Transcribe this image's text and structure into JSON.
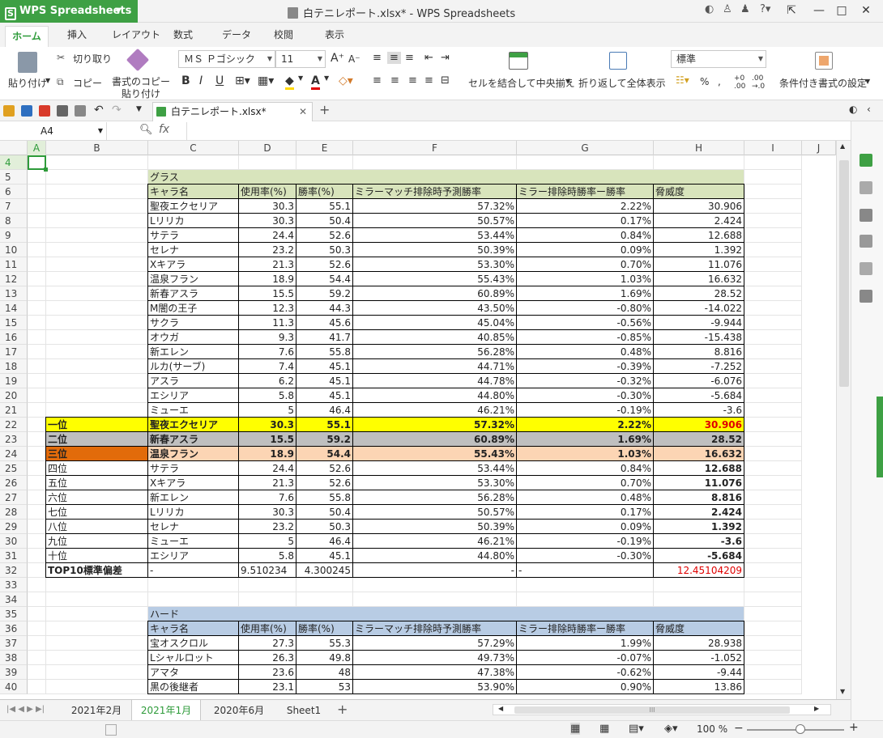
{
  "app": {
    "name": "WPS Spreadsheets",
    "window_title": "白テニレポート.xlsx* - WPS Spreadsheets",
    "doc_tab": "白テニレポート.xlsx*"
  },
  "menu": [
    "ホーム",
    "挿入",
    "レイアウト",
    "数式",
    "データ",
    "校閲",
    "表示"
  ],
  "ribbon": {
    "paste": "貼り付け",
    "cut": "切り取り",
    "copy": "コピー",
    "format_copy_1": "書式のコピー",
    "format_copy_2": "貼り付け",
    "font": "ＭＳ Ｐゴシック",
    "size": "11",
    "bold": "B",
    "italic": "I",
    "underline": "U",
    "merge": "セルを結合して中央揃え",
    "wrap": "折り返して全体表示",
    "numfmt": "標準",
    "percent": "%",
    "comma": ",",
    "cond": "条件付き書式の設定"
  },
  "namebox": "A4",
  "fx": "fx",
  "columns": [
    "A",
    "B",
    "C",
    "D",
    "E",
    "F",
    "G",
    "H",
    "I",
    "J"
  ],
  "rows": [
    "4",
    "5",
    "6",
    "7",
    "8",
    "9",
    "10",
    "11",
    "12",
    "13",
    "14",
    "15",
    "16",
    "17",
    "18",
    "19",
    "20",
    "21",
    "22",
    "23",
    "24",
    "25",
    "26",
    "27",
    "28",
    "29",
    "30",
    "31",
    "32",
    "33",
    "34",
    "35",
    "36",
    "37",
    "38",
    "39",
    "40"
  ],
  "grass": {
    "title": "グラス",
    "headers": [
      "キャラ名",
      "使用率(%)",
      "勝率(%)",
      "ミラーマッチ排除時予測勝率",
      "ミラー排除時勝率ー勝率",
      "脅威度"
    ],
    "rows": [
      [
        "聖夜エクセリア",
        "30.3",
        "55.1",
        "57.32%",
        "2.22%",
        "30.906"
      ],
      [
        "Lリリカ",
        "30.3",
        "50.4",
        "50.57%",
        "0.17%",
        "2.424"
      ],
      [
        "サテラ",
        "24.4",
        "52.6",
        "53.44%",
        "0.84%",
        "12.688"
      ],
      [
        "セレナ",
        "23.2",
        "50.3",
        "50.39%",
        "0.09%",
        "1.392"
      ],
      [
        "Xキアラ",
        "21.3",
        "52.6",
        "53.30%",
        "0.70%",
        "11.076"
      ],
      [
        "温泉フラン",
        "18.9",
        "54.4",
        "55.43%",
        "1.03%",
        "16.632"
      ],
      [
        "新春アスラ",
        "15.5",
        "59.2",
        "60.89%",
        "1.69%",
        "28.52"
      ],
      [
        "M闇の王子",
        "12.3",
        "44.3",
        "43.50%",
        "-0.80%",
        "-14.022"
      ],
      [
        "サクラ",
        "11.3",
        "45.6",
        "45.04%",
        "-0.56%",
        "-9.944"
      ],
      [
        "オウガ",
        "9.3",
        "41.7",
        "40.85%",
        "-0.85%",
        "-15.438"
      ],
      [
        "新エレン",
        "7.6",
        "55.8",
        "56.28%",
        "0.48%",
        "8.816"
      ],
      [
        "ルカ(サーブ)",
        "7.4",
        "45.1",
        "44.71%",
        "-0.39%",
        "-7.252"
      ],
      [
        "アスラ",
        "6.2",
        "45.1",
        "44.78%",
        "-0.32%",
        "-6.076"
      ],
      [
        "エシリア",
        "5.8",
        "45.1",
        "44.80%",
        "-0.30%",
        "-5.684"
      ],
      [
        "ミューエ",
        "5",
        "46.4",
        "46.21%",
        "-0.19%",
        "-3.6"
      ]
    ]
  },
  "ranking": [
    [
      "一位",
      "聖夜エクセリア",
      "30.3",
      "55.1",
      "57.32%",
      "2.22%",
      "30.906"
    ],
    [
      "二位",
      "新春アスラ",
      "15.5",
      "59.2",
      "60.89%",
      "1.69%",
      "28.52"
    ],
    [
      "三位",
      "温泉フラン",
      "18.9",
      "54.4",
      "55.43%",
      "1.03%",
      "16.632"
    ],
    [
      "四位",
      "サテラ",
      "24.4",
      "52.6",
      "53.44%",
      "0.84%",
      "12.688"
    ],
    [
      "五位",
      "Xキアラ",
      "21.3",
      "52.6",
      "53.30%",
      "0.70%",
      "11.076"
    ],
    [
      "六位",
      "新エレン",
      "7.6",
      "55.8",
      "56.28%",
      "0.48%",
      "8.816"
    ],
    [
      "七位",
      "Lリリカ",
      "30.3",
      "50.4",
      "50.57%",
      "0.17%",
      "2.424"
    ],
    [
      "八位",
      "セレナ",
      "23.2",
      "50.3",
      "50.39%",
      "0.09%",
      "1.392"
    ],
    [
      "九位",
      "ミューエ",
      "5",
      "46.4",
      "46.21%",
      "-0.19%",
      "-3.6"
    ],
    [
      "十位",
      "エシリア",
      "5.8",
      "45.1",
      "44.80%",
      "-0.30%",
      "-5.684"
    ]
  ],
  "stddev": [
    "TOP10標準偏差",
    "-",
    "9.510234",
    "4.300245",
    "-",
    "-",
    "12.45104209"
  ],
  "hard": {
    "title": "ハード",
    "headers": [
      "キャラ名",
      "使用率(%)",
      "勝率(%)",
      "ミラーマッチ排除時予測勝率",
      "ミラー排除時勝率ー勝率",
      "脅威度"
    ],
    "rows": [
      [
        "宝オスクロル",
        "27.3",
        "55.3",
        "57.29%",
        "1.99%",
        "28.938"
      ],
      [
        "Lシャルロット",
        "26.3",
        "49.8",
        "49.73%",
        "-0.07%",
        "-1.052"
      ],
      [
        "アマタ",
        "23.6",
        "48",
        "47.38%",
        "-0.62%",
        "-9.44"
      ],
      [
        "黒の後継者",
        "23.1",
        "53",
        "53.90%",
        "0.90%",
        "13.86"
      ]
    ]
  },
  "sheets": [
    "2021年2月",
    "2021年1月",
    "2020年6月",
    "Sheet1"
  ],
  "active_sheet": "2021年1月",
  "zoom": "100 %",
  "colors": {
    "accent": "#3ea044",
    "grass": "#d8e4bc",
    "hard": "#b8cce4",
    "first": "#ffff00",
    "second": "#bfbfbf",
    "third": "#e26b0a",
    "third_light": "#fcd5b4"
  }
}
